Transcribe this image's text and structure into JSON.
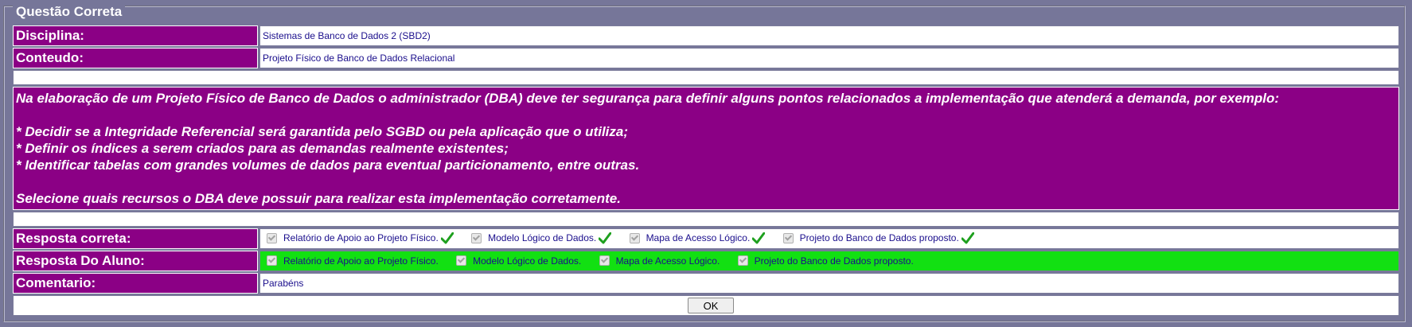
{
  "legend": "Questão Correta",
  "disciplina": {
    "label": "Disciplina:",
    "value": "Sistemas de Banco de Dados 2 (SBD2)"
  },
  "conteudo": {
    "label": "Conteudo:",
    "value": "Projeto Físico de Banco de Dados Relacional"
  },
  "question": {
    "line1": "Na elaboração de um Projeto Físico de Banco de Dados o administrador (DBA) deve ter segurança para definir alguns pontos relacionados a implementação que atenderá a demanda, por exemplo:",
    "bullet1": "* Decidir se a Integridade Referencial será garantida pelo SGBD ou pela aplicação que o utiliza;",
    "bullet2": "* Definir os índices a serem criados para as demandas realmente existentes;",
    "bullet3": "* Identificar tabelas com grandes volumes de dados para eventual particionamento, entre outras.",
    "closing": "Selecione quais recursos o DBA deve possuir para realizar esta implementação corretamente."
  },
  "resposta_correta": {
    "label": "Resposta correta:",
    "options": [
      "Relatório de Apoio ao Projeto Físico.",
      "Modelo Lógico de Dados.",
      "Mapa de Acesso Lógico.",
      "Projeto do Banco de Dados proposto."
    ]
  },
  "resposta_aluno": {
    "label": "Resposta Do Aluno:",
    "options": [
      "Relatório de Apoio ao Projeto Físico.",
      "Modelo Lógico de Dados.",
      "Mapa de Acesso Lógico.",
      "Projeto do Banco de Dados proposto."
    ]
  },
  "comentario": {
    "label": "Comentario:",
    "value": "Parabéns"
  },
  "ok_button": "OK",
  "colors": {
    "label_bg": "#8b0085",
    "student_bg": "#12e012",
    "page_bg": "#767699",
    "text": "#1a0e8c"
  },
  "icons": {
    "correct_mark": "green-checkmark-icon"
  }
}
